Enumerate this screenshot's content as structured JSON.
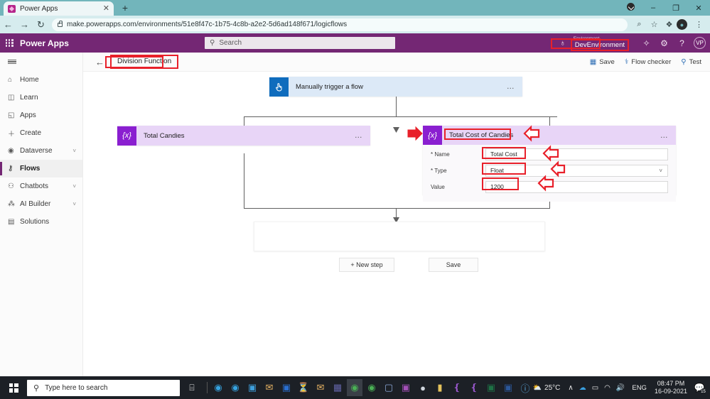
{
  "browser": {
    "tab_title": "Power Apps",
    "tab_close_icon": "close-icon",
    "new_tab_icon": "+",
    "back_icon": "←",
    "forward_icon": "→",
    "reload_icon": "↻",
    "url": "make.powerapps.com/environments/51e8f47c-1b75-4c8b-a2e2-5d6ad148f671/logicflows",
    "zoom_icon": "⌕",
    "bookmark_icon": "☆",
    "extensions_icon": "❖",
    "profile_initial": "●",
    "menu_icon": "⋮",
    "minimize_icon": "–",
    "maximize_icon": "❐",
    "close_window_icon": "✕"
  },
  "powerapps_header": {
    "waffle_icon": "waffle-icon",
    "brand": "Power Apps",
    "search_placeholder": "Search",
    "search_icon": "search-icon",
    "environment_label": "Environment",
    "environment_name": "DevEnvironment",
    "globe_icon": "♁",
    "notification_icon": "✧",
    "settings_icon": "⚙",
    "help_icon": "?",
    "avatar_initials": "VP"
  },
  "sidebar": {
    "hamburger_icon": "hamburger-icon",
    "items": [
      {
        "label": "Home",
        "icon": "⌂",
        "expandable": false,
        "active": false
      },
      {
        "label": "Learn",
        "icon": "◫",
        "expandable": false,
        "active": false
      },
      {
        "label": "Apps",
        "icon": "◱",
        "expandable": false,
        "active": false
      },
      {
        "label": "Create",
        "icon": "＋",
        "expandable": false,
        "active": false
      },
      {
        "label": "Dataverse",
        "icon": "◉",
        "expandable": true,
        "active": false
      },
      {
        "label": "Flows",
        "icon": "⚷",
        "expandable": false,
        "active": true
      },
      {
        "label": "Chatbots",
        "icon": "⚇",
        "expandable": true,
        "active": false
      },
      {
        "label": "AI Builder",
        "icon": "⁂",
        "expandable": true,
        "active": false
      },
      {
        "label": "Solutions",
        "icon": "▤",
        "expandable": false,
        "active": false
      }
    ],
    "chevron_icon": "˅"
  },
  "commandbar": {
    "back_icon": "←",
    "flow_title": "Division Function",
    "buttons": [
      {
        "label": "Save",
        "icon": "Ὃe"
      },
      {
        "label": "Flow checker",
        "icon": "⚕"
      },
      {
        "label": "Test",
        "icon": "⚲"
      }
    ],
    "save_icon": "▣",
    "checker_icon": "⚕",
    "test_icon": "⚲"
  },
  "flow": {
    "trigger": {
      "title": "Manually trigger a flow",
      "icon": "trigger-hand-icon",
      "menu_icon": "…"
    },
    "variable_left": {
      "title": "Total Candies",
      "icon": "{x}",
      "menu_icon": "…"
    },
    "variable_right": {
      "title": "Total Cost of Candies",
      "icon": "{x}",
      "menu_icon": "…",
      "fields": [
        {
          "label": "* Name",
          "value": "Total Cost",
          "type": "text"
        },
        {
          "label": "* Type",
          "value": "Float",
          "type": "dropdown"
        },
        {
          "label": "Value",
          "value": "1200",
          "type": "text"
        }
      ],
      "dropdown_chevron": "˅"
    },
    "buttons": {
      "new_step": "+ New step",
      "save": "Save"
    }
  },
  "annotations": {
    "highlight_color": "#e8202a",
    "arrow_icon": "arrow-marker"
  },
  "taskbar": {
    "start_icon": "windows-start-icon",
    "search_placeholder": "Type here to search",
    "search_icon": "search-icon",
    "taskview_icon": "⌸",
    "temperature": "25°C",
    "weather_icon": "⛅",
    "chevron_up_icon": "∧",
    "cloud_icon": "☁",
    "battery_icon": "▭",
    "wifi_icon": "◠",
    "volume_icon": "ὐa",
    "language": "ENG",
    "time": "08:47 PM",
    "date": "16-09-2021",
    "notification_count": "15"
  }
}
